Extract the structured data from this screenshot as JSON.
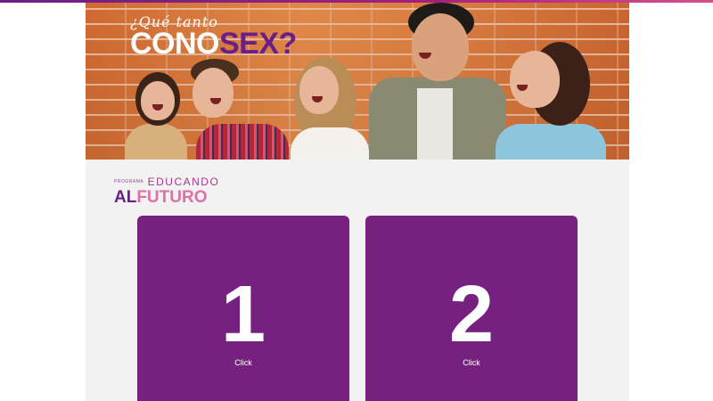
{
  "hero": {
    "question_prefix": "¿Qué tanto",
    "title_white": "CONO",
    "title_purple": "SEX?"
  },
  "logo": {
    "small": "PROGRAMA",
    "top": "EDUCANDO",
    "al": "AL",
    "futuro": "FUTURO"
  },
  "cards": [
    {
      "number": "1",
      "label": "Click"
    },
    {
      "number": "2",
      "label": "Click"
    }
  ],
  "colors": {
    "card_purple": "#76217f",
    "brand_purple": "#6a1f84",
    "brand_pink": "#e06fa6",
    "brick": "#d9763c",
    "page_bg": "#f2f2f3"
  }
}
